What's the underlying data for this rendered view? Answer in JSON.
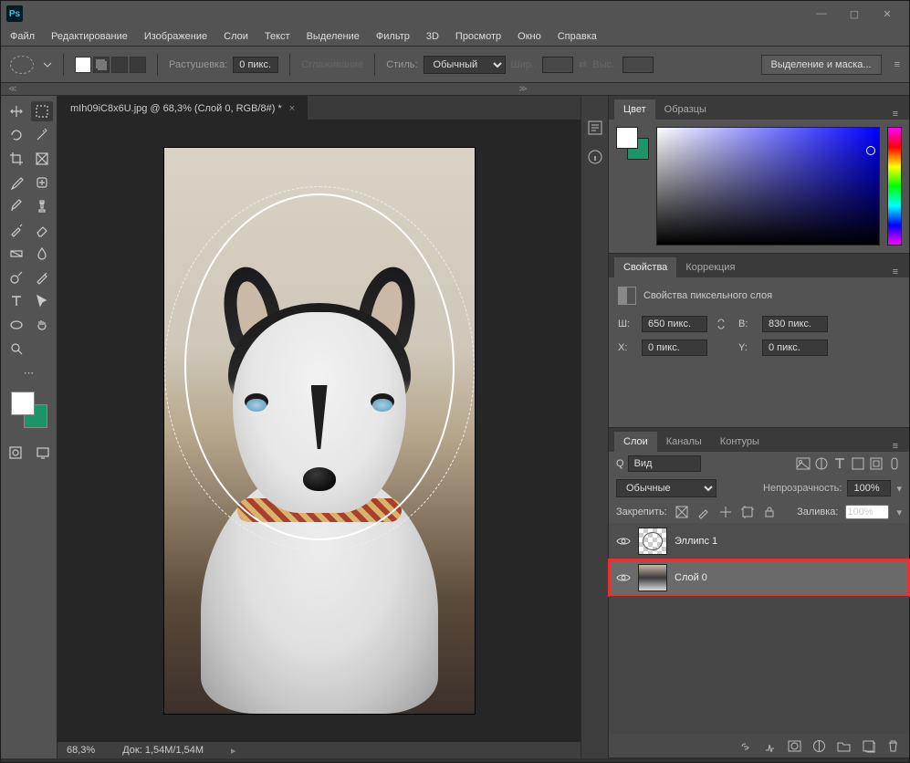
{
  "menubar": [
    "Файл",
    "Редактирование",
    "Изображение",
    "Слои",
    "Текст",
    "Выделение",
    "Фильтр",
    "3D",
    "Просмотр",
    "Окно",
    "Справка"
  ],
  "options": {
    "feather_label": "Растушевка:",
    "feather_value": "0 пикс.",
    "antialias_label": "Сглаживание",
    "style_label": "Стиль:",
    "style_value": "Обычный",
    "width_label": "Шир.:",
    "height_label": "Выс.:",
    "mask_button": "Выделение и маска..."
  },
  "document": {
    "tab_title": "mIh09iC8x6U.jpg @ 68,3% (Слой 0, RGB/8#) *",
    "zoom": "68,3%",
    "doc_status_label": "Док:",
    "doc_status": "1,54M/1,54M"
  },
  "panels": {
    "color": {
      "tabs": [
        "Цвет",
        "Образцы"
      ],
      "active": 0
    },
    "properties": {
      "tabs": [
        "Свойства",
        "Коррекция"
      ],
      "active": 0,
      "title": "Свойства пиксельного слоя",
      "w_label": "Ш:",
      "w_value": "650 пикс.",
      "h_label": "В:",
      "h_value": "830 пикс.",
      "x_label": "X:",
      "x_value": "0 пикс.",
      "y_label": "Y:",
      "y_value": "0 пикс."
    },
    "layers": {
      "tabs": [
        "Слои",
        "Каналы",
        "Контуры"
      ],
      "active": 0,
      "search_prefix": "Q",
      "search_value": "Вид",
      "blend_mode": "Обычные",
      "opacity_label": "Непрозрачность:",
      "opacity_value": "100%",
      "lock_label": "Закрепить:",
      "fill_label": "Заливка:",
      "fill_value": "100%",
      "items": [
        {
          "name": "Эллипс 1",
          "selected": false,
          "thumb": "ellipse"
        },
        {
          "name": "Слой 0",
          "selected": true,
          "thumb": "dog"
        }
      ]
    }
  }
}
